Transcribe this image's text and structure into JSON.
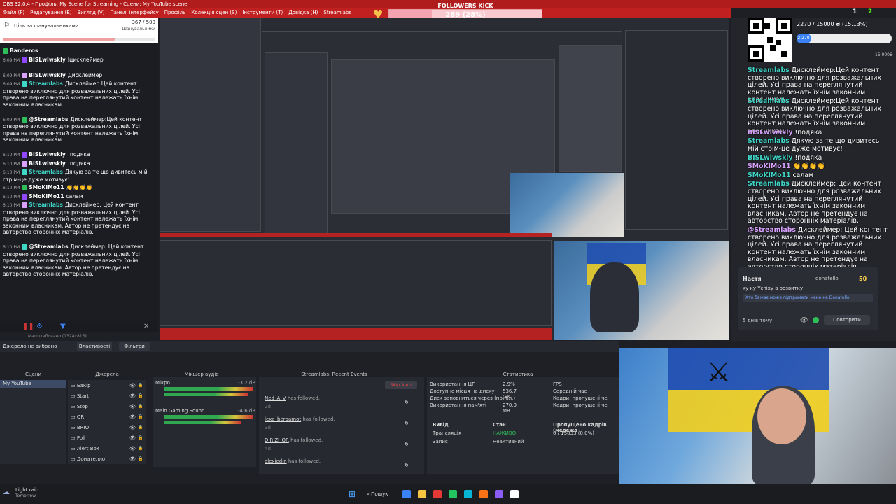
{
  "window": {
    "title": "OBS 32.0.4 - Профіль: My Scene for Streaming - Сцени: My YouTube scene",
    "menu": [
      "Файл (F)",
      "Редагування (E)",
      "Вигляд (V)",
      "Панелі інтерфейсу",
      "Профіль",
      "Колекція сцен (S)",
      "Інструменти (T)",
      "Довідка (H)",
      "Streamlabs"
    ]
  },
  "followers_widget": {
    "title": "FOLLOWERS KICK",
    "value_text": "289 (28%)",
    "progress": 0.28,
    "min": "0",
    "max": "1000",
    "accent": "#f5a3b0"
  },
  "goal": {
    "title": "Ціль за шанувальниками",
    "count": "367 / 500",
    "subtitle": "Шанувальники",
    "progress": 0.734
  },
  "left_chat": [
    {
      "time": "",
      "user": "Banderos",
      "text": ""
    },
    {
      "time": "6:09 PM",
      "user": "BISLwlwskly",
      "text": "Іцисклеймер",
      "color": "#ffffff"
    },
    {
      "time": "6:09 PM",
      "user": "BISLwlwskly",
      "text": "Дисклеймер",
      "color": "#ffffff"
    },
    {
      "time": "6:09 PM",
      "user": "Streamlabs",
      "text": "Дисклеймер:Цей контент створено виключно для розважальних цілей. Усі права на переглянутий контент належать їхнім законним власникам.",
      "color": "#3fd7c8"
    },
    {
      "time": "6:09 PM",
      "user": "@Streamlabs",
      "text": "Дисклеймер:Цей контент створено виключно для розважальних цілей. Усі права на переглянутий контент належать їхнім законним власникам.",
      "color": "#ffffff"
    },
    {
      "time": "6:10 PM",
      "user": "BISLwlwskly",
      "text": "!подяка",
      "color": "#ffffff"
    },
    {
      "time": "6:10 PM",
      "user": "BISLwlwskly",
      "text": "!подяка",
      "color": "#ffffff"
    },
    {
      "time": "6:10 PM",
      "user": "Streamlabs",
      "text": "Дякую за те що дивитесь мій стрім-це дуже мотивує!",
      "color": "#3fd7c8"
    },
    {
      "time": "6:10 PM",
      "user": "SMoKIMo11",
      "text": "👏👏👏👏",
      "color": "#ffffff"
    },
    {
      "time": "6:10 PM",
      "user": "SMoKIMo11",
      "text": "салам",
      "color": "#ffffff"
    },
    {
      "time": "6:10 PM",
      "user": "Streamlabs",
      "text": "Дисклеймер: Цей контент створено виключно для розважальних цілей. Усі права на переглянутий контент належать їхнім законним власникам. Автор не претендує на авторство сторонніх матеріалів.",
      "color": "#3fd7c8"
    },
    {
      "time": "6:10 PM",
      "user": "@Streamlabs",
      "text": "Дисклеймер: Цей контент створено виключно для розважальних цілей. Усі права на переглянутий контент належать їхнім законним власникам. Автор не претендує на авторство сторонніх матеріалів.",
      "color": "#ffffff"
    }
  ],
  "right_overlay": {
    "qr_progress_text": "2270 / 15000 ₴ (15.13%)",
    "qr_badge": "2 270",
    "qr_max": "15 000₴",
    "qr_progress": 0.1513,
    "chat": [
      {
        "user": "Streamlabs",
        "text": "Дисклеймер:Цей контент створено виключно для розважальних цілей. Усі права на переглянутий контент належать їхнім законним власникам."
      },
      {
        "user": "Streamlabs",
        "text": "Дисклеймер:Цей контент створено виключно для розважальних цілей. Усі права на переглянутий контент належать їхнім законним власникам."
      },
      {
        "user": "BISLwlwskly",
        "text": "!подяка"
      },
      {
        "user": "Streamlabs",
        "text": "Дякую за те що дивитесь мій стрім-це дуже мотивує!"
      },
      {
        "user": "BISLwlwskly",
        "text": "!подяка"
      },
      {
        "user": "SMoKIMo11",
        "text": "👏👏👏👏"
      },
      {
        "user": "SMoKIMo11",
        "text": "салам"
      },
      {
        "user": "Streamlabs",
        "text": "Дисклеймер: Цей контент створено виключно для розважальних цілей. Усі права на переглянутий контент належать їхнім законним власникам. Автор не претендує на авторство сторонніх матеріалів."
      },
      {
        "user": "@Streamlabs",
        "text": "Дисклеймер: Цей контент створено виключно для розважальних цілей. Усі права на переглянутий контент належать їхнім законним власникам. Автор не претендує на авторство сторонніх матеріалів."
      }
    ],
    "donation": {
      "name": "Настя",
      "to": "donatello",
      "amount": "50",
      "message": "ку ку Ycnіxy в розвитку",
      "link_text": "Хто бажає може підтримати мене на Donatello!",
      "age": "5 днів тому",
      "repeat_label": "Повторити",
      "stop_label": "Зупинити"
    }
  },
  "docks": {
    "source_none": "Джерело не вибрано",
    "properties_btn": "Властивості",
    "filters_btn": "Фільтри",
    "scenes_title": "Сцени",
    "sources_title": "Джерела",
    "mixer_title": "Мікшер аудіо",
    "events_title": "Streamlabs: Recent Events",
    "stats_title": "Статистика",
    "scenes": [
      "My YouTube"
    ],
    "sources": [
      "Бакір",
      "Start",
      "Stop",
      "QR",
      "BRIO",
      "Poll",
      "Alert Box",
      "Донателло"
    ],
    "mixer": [
      {
        "name": "Мікро",
        "db": "-3.2 dB"
      },
      {
        "name": "Main Gaming Sound",
        "db": "-4.6 dB"
      }
    ],
    "skip_alert": "Skip Alert",
    "events": [
      {
        "user": "Ned_A_V",
        "text": "has followed.",
        "age": "2d"
      },
      {
        "user": "lexa_bergamot",
        "text": "has followed.",
        "age": "3d"
      },
      {
        "user": "DIRIZHOR",
        "text": "has followed.",
        "age": "4d"
      },
      {
        "user": "alexjedin",
        "text": "has followed.",
        "age": ""
      }
    ],
    "stats": [
      {
        "label": "Використання ЦП",
        "value": "2,9%"
      },
      {
        "label": "Доступно місця на диску",
        "value": "536,7 GB"
      },
      {
        "label": "Диск заповниться через (прибл.)",
        "value": ""
      },
      {
        "label": "Використання пам'яті",
        "value": "270,9 MB"
      }
    ],
    "stats_right": [
      "FPS",
      "Середній час",
      "Кадри, пропущені че",
      "Кадри, пропущені че"
    ],
    "output_head": [
      "Вивід",
      "Стан",
      "Пропущено кадрів (мережа"
    ],
    "output_rows": [
      {
        "name": "Трансляція",
        "state": "НАЖИВО",
        "dropped": "0 / 15833 (0,0%)"
      },
      {
        "name": "Запис",
        "state": "Неактивний",
        "dropped": ""
      }
    ]
  },
  "taskbar": {
    "weather_title": "Light rain",
    "weather_sub": "Tomorrow",
    "search_label": "Пошук",
    "icon_colors": [
      "#3b82f6",
      "#f5c542",
      "#e53935",
      "#22c55e",
      "#06b6d4",
      "#f97316",
      "#8b5cf6",
      "#ffffff"
    ]
  },
  "zoom_label": "Масштабовано (1324x813)",
  "channel_badge_kick": "2",
  "channel_badge_1": "1"
}
